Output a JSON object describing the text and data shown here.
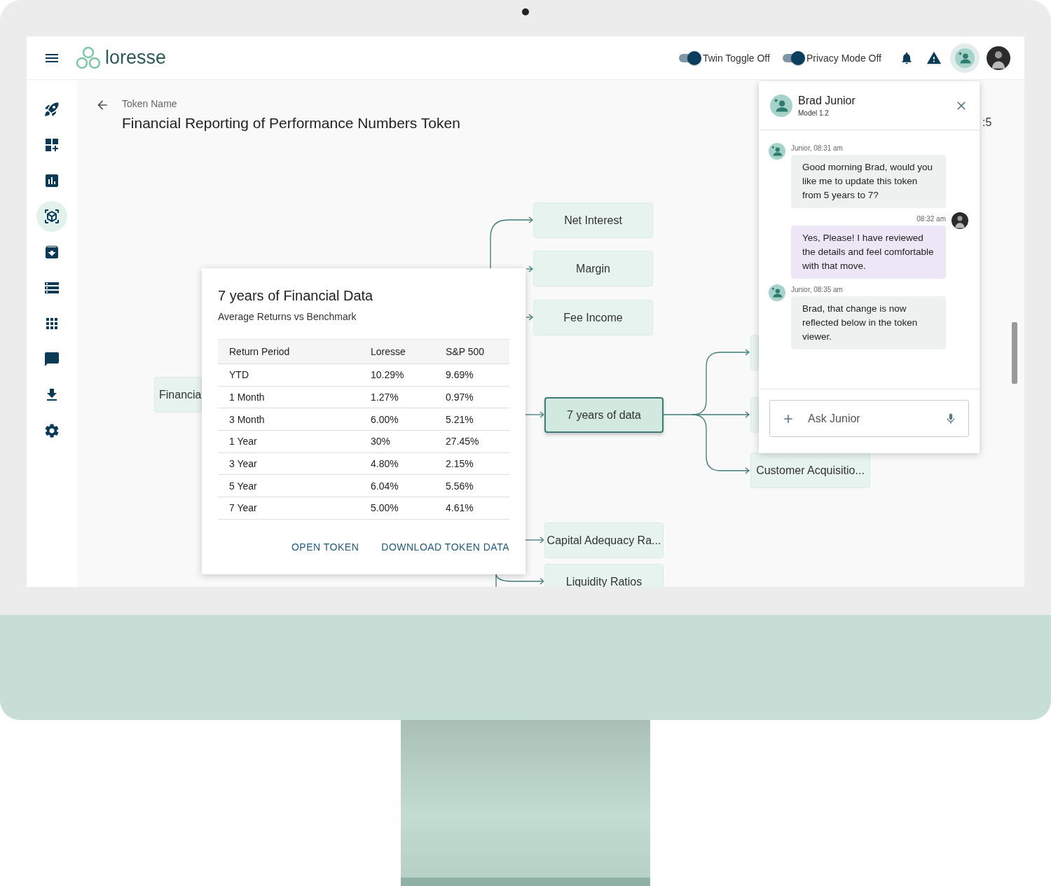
{
  "header": {
    "logo": "loresse",
    "toggles": [
      {
        "label": "Twin Toggle Off",
        "on": true
      },
      {
        "label": "Privacy Mode Off",
        "on": true
      }
    ]
  },
  "sidebar": {
    "items": [
      {
        "kind": "rocket",
        "selected": false
      },
      {
        "kind": "dashboard",
        "selected": false
      },
      {
        "kind": "chart",
        "selected": false
      },
      {
        "kind": "cube",
        "selected": true
      },
      {
        "kind": "archive",
        "selected": false
      },
      {
        "kind": "list",
        "selected": false
      },
      {
        "kind": "apps",
        "selected": false
      },
      {
        "kind": "chat",
        "selected": false
      },
      {
        "kind": "download",
        "selected": false
      },
      {
        "kind": "settings",
        "selected": false
      }
    ]
  },
  "page": {
    "breadcrumb": "Token Name",
    "title": "Financial Reporting of Performance Numbers Token",
    "partial_text": ":5"
  },
  "diagram": {
    "nodes": [
      {
        "label": "Financia",
        "selected": false
      },
      {
        "label": "Net Interest",
        "selected": false
      },
      {
        "label": "Margin",
        "selected": false
      },
      {
        "label": "Fee Income",
        "selected": false
      },
      {
        "label": "7 years of data",
        "selected": true
      },
      {
        "label": "Capital Adequacy Ra...",
        "selected": false
      },
      {
        "label": "Liquidity Ratios",
        "selected": false
      },
      {
        "label": "Customer Acquisitio...",
        "selected": false
      }
    ]
  },
  "popup": {
    "title": "7 years of Financial Data",
    "subtitle": "Average Returns vs Benchmark",
    "table": {
      "columns": [
        "Return Period",
        "Loresse",
        "S&P 500"
      ],
      "rows": [
        [
          "YTD",
          "10.29%",
          "9.69%"
        ],
        [
          "1 Month",
          "1.27%",
          "0.97%"
        ],
        [
          "3 Month",
          "6.00%",
          "5.21%"
        ],
        [
          "1 Year",
          "30%",
          "27.45%"
        ],
        [
          "3 Year",
          "4.80%",
          "2.15%"
        ],
        [
          "5 Year",
          "6.04%",
          "5.56%"
        ],
        [
          "7 Year",
          "5.00%",
          "4.61%"
        ]
      ]
    },
    "buttons": [
      "OPEN TOKEN",
      "DOWNLOAD TOKEN DATA"
    ]
  },
  "chat": {
    "name": "Brad Junior",
    "model": "Model 1.2",
    "messages": [
      {
        "kind": "bot",
        "meta": "Junior, 08:31 am",
        "text": "Good morning Brad, would you like me to update this token from 5 years to 7?"
      },
      {
        "kind": "user",
        "meta": "08:32 am",
        "text": "Yes, Please! I have reviewed the details and feel comfortable with that move."
      },
      {
        "kind": "bot",
        "meta": "Junior, 08:35 am",
        "text": "Brad, that change is now reflected below in the token viewer."
      }
    ],
    "input": {
      "placeholder": "Ask Junior"
    }
  }
}
